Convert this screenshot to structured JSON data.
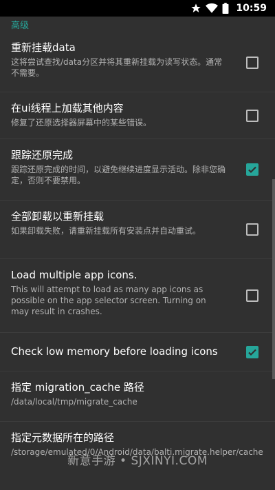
{
  "status_bar": {
    "time": "10:59",
    "icons": [
      "star-icon",
      "wifi-icon",
      "battery-icon"
    ]
  },
  "section": {
    "header": "高级"
  },
  "preferences": [
    {
      "title": "重新挂载data",
      "summary": "这将尝试查找/data分区并将其重新挂载为读写状态。通常不需要。",
      "checked": false
    },
    {
      "title": "在ui线程上加载其他内容",
      "summary": "修复了还原选择器屏幕中的某些错误。",
      "checked": false
    },
    {
      "title": "跟踪还原完成",
      "summary": "跟踪还原完成的时间，以避免继续进度显示活动。除非您确定，否则不要禁用。",
      "checked": true
    },
    {
      "title": "全部卸载以重新挂载",
      "summary": "如果卸载失败，请重新挂载所有安装点并自动重试。",
      "checked": false
    },
    {
      "title": "Load multiple app icons.",
      "summary": "This will attempt to load as many app icons as possible on the app selector screen. Turning on may result in crashes.",
      "checked": false
    },
    {
      "title": "Check low memory before loading icons",
      "summary": "",
      "checked": true
    },
    {
      "title": "指定 migration_cache 路径",
      "summary": "/data/local/tmp/migrate_cache"
    },
    {
      "title": "指定元数据所在的路径",
      "summary": "/storage/emulated/0/Android/data/balti.migrate.helper/cache"
    }
  ],
  "watermark": "新意手游 • SJXINYI.COM",
  "colors": {
    "accent": "#26a69a",
    "background": "#303030",
    "divider": "#3c3c3c"
  }
}
